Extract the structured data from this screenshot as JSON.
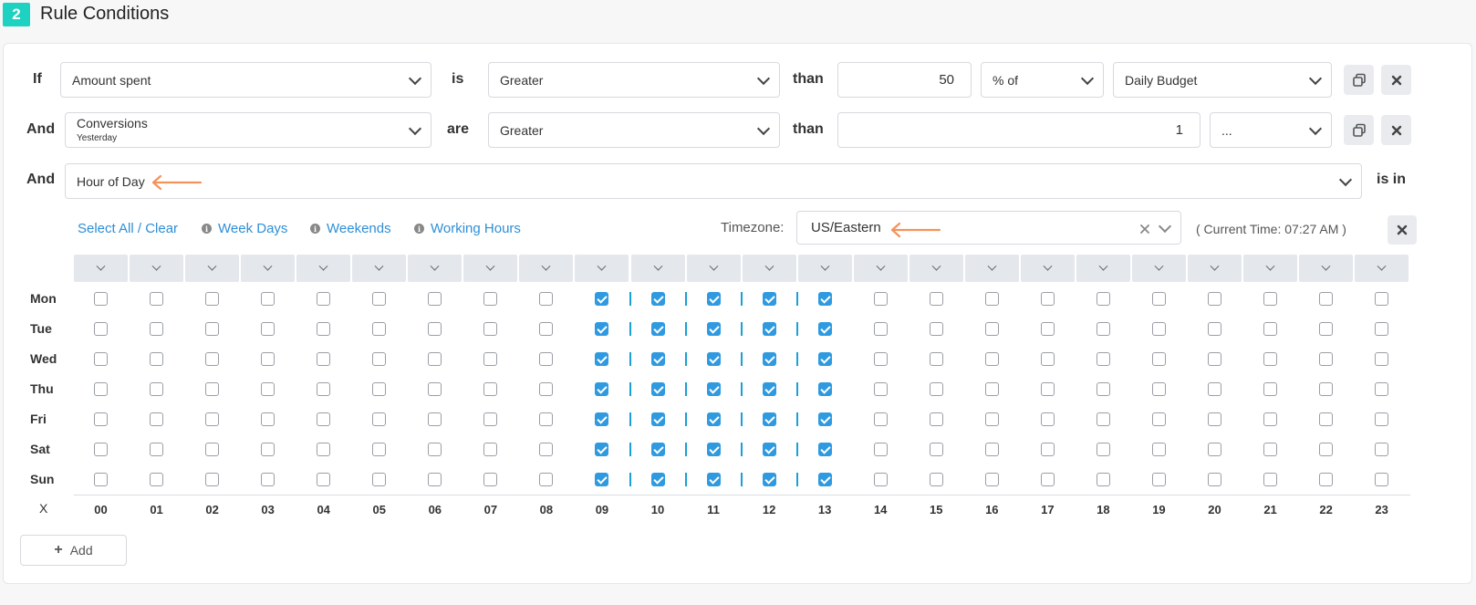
{
  "section": {
    "step": "2",
    "title": "Rule Conditions"
  },
  "conditions": [
    {
      "keyword": "If",
      "metric": "Amount spent",
      "metric_sub": "",
      "verb": "is",
      "operator": "Greater",
      "than": "than",
      "value": "50",
      "unit": "% of",
      "target": "Daily Budget"
    },
    {
      "keyword": "And",
      "metric": "Conversions",
      "metric_sub": "Yesterday",
      "verb": "are",
      "operator": "Greater",
      "than": "than",
      "value": "1",
      "unit": "...",
      "target": ""
    },
    {
      "keyword": "And",
      "metric": "Hour of Day",
      "verb": "is in"
    }
  ],
  "schedule": {
    "links": {
      "select_all": "Select All / Clear",
      "week_days": "Week Days",
      "weekends": "Weekends",
      "working_hours": "Working Hours"
    },
    "timezone_label": "Timezone:",
    "timezone_value": "US/Eastern",
    "current_time": "( Current Time: 07:27 AM )",
    "days": [
      "Mon",
      "Tue",
      "Wed",
      "Thu",
      "Fri",
      "Sat",
      "Sun"
    ],
    "hours": [
      "00",
      "01",
      "02",
      "03",
      "04",
      "05",
      "06",
      "07",
      "08",
      "09",
      "10",
      "11",
      "12",
      "13",
      "14",
      "15",
      "16",
      "17",
      "18",
      "19",
      "20",
      "21",
      "22",
      "23"
    ],
    "selected_hours": [
      9,
      10,
      11,
      12,
      13
    ],
    "corner_label": "X"
  },
  "add_button": "Add",
  "accent_colors": {
    "badge": "#1fd1c0",
    "link": "#2e8fd6",
    "checkbox": "#2f9ae0",
    "arrow": "#f4935a"
  },
  "icons": [
    "chevron-down-icon",
    "copy-icon",
    "close-icon",
    "info-icon",
    "plus-icon",
    "arrow-left-icon"
  ]
}
